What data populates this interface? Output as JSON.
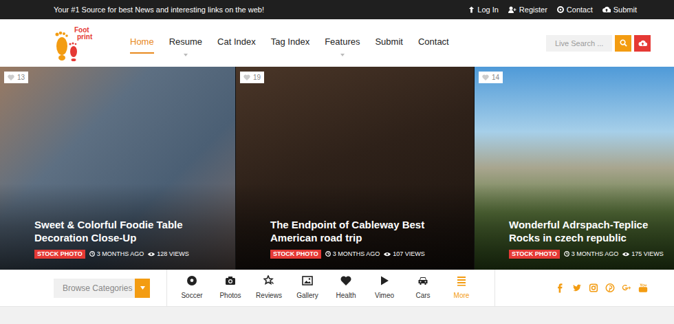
{
  "top_bar": {
    "tagline": "Your #1 Source for best News and interesting links on the web!",
    "links": [
      {
        "label": "Log In"
      },
      {
        "label": "Register"
      },
      {
        "label": "Contact"
      },
      {
        "label": "Submit"
      }
    ]
  },
  "logo": {
    "line1": "Foot",
    "line2": "print"
  },
  "nav": [
    {
      "label": "Home",
      "selected": true,
      "has_submenu": false
    },
    {
      "label": "Resume",
      "selected": false,
      "has_submenu": true
    },
    {
      "label": "Cat Index",
      "selected": false,
      "has_submenu": false
    },
    {
      "label": "Tag Index",
      "selected": false,
      "has_submenu": false
    },
    {
      "label": "Features",
      "selected": false,
      "has_submenu": true
    },
    {
      "label": "Submit",
      "selected": false,
      "has_submenu": false
    },
    {
      "label": "Contact",
      "selected": false,
      "has_submenu": false
    }
  ],
  "search": {
    "placeholder": "Live Search ..."
  },
  "posts": [
    {
      "likes": "13",
      "title": "Sweet & Colorful Foodie Table Decoration Close-Up",
      "tag": "STOCK PHOTO",
      "age": "3 MONTHS AGO",
      "views": "128 VIEWS"
    },
    {
      "likes": "19",
      "title": "The Endpoint of Cableway Best American road trip",
      "tag": "STOCK PHOTO",
      "age": "3 MONTHS AGO",
      "views": "107 VIEWS"
    },
    {
      "likes": "14",
      "title": "Wonderful Adrspach-Teplice Rocks in czech republic",
      "tag": "STOCK PHOTO",
      "age": "3 MONTHS AGO",
      "views": "175 VIEWS"
    }
  ],
  "browse": {
    "label": "Browse Categories"
  },
  "categories": [
    {
      "label": "Soccer",
      "selected": false
    },
    {
      "label": "Photos",
      "selected": false
    },
    {
      "label": "Reviews",
      "selected": false
    },
    {
      "label": "Gallery",
      "selected": false
    },
    {
      "label": "Health",
      "selected": false
    },
    {
      "label": "Vimeo",
      "selected": false
    },
    {
      "label": "Cars",
      "selected": false
    },
    {
      "label": "More",
      "selected": true
    }
  ]
}
